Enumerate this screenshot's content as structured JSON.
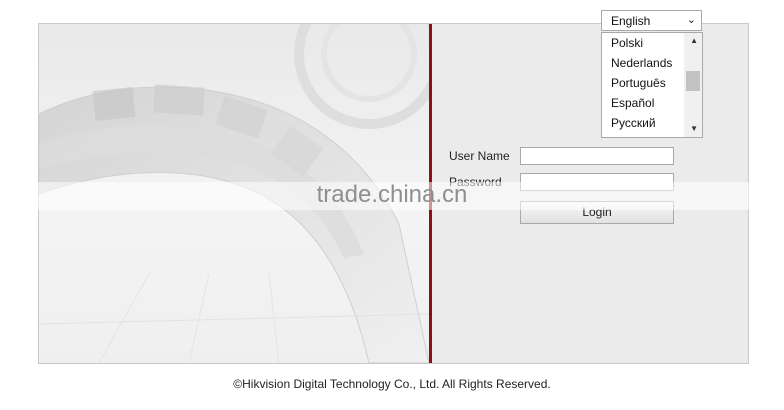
{
  "language": {
    "selected": "English",
    "options": [
      "Polski",
      "Nederlands",
      "Português",
      "Español",
      "Русский"
    ],
    "partial_option": "...",
    "chevron_icon": "chevron-down-icon"
  },
  "login": {
    "username_label": "User Name",
    "password_label": "Password",
    "username_value": "",
    "password_value": "",
    "button_label": "Login"
  },
  "watermark": "trade.china.cn",
  "footer": "©Hikvision Digital Technology Co., Ltd. All Rights Reserved.",
  "colors": {
    "divider": "#8b1117",
    "panel": "#ebebeb"
  }
}
